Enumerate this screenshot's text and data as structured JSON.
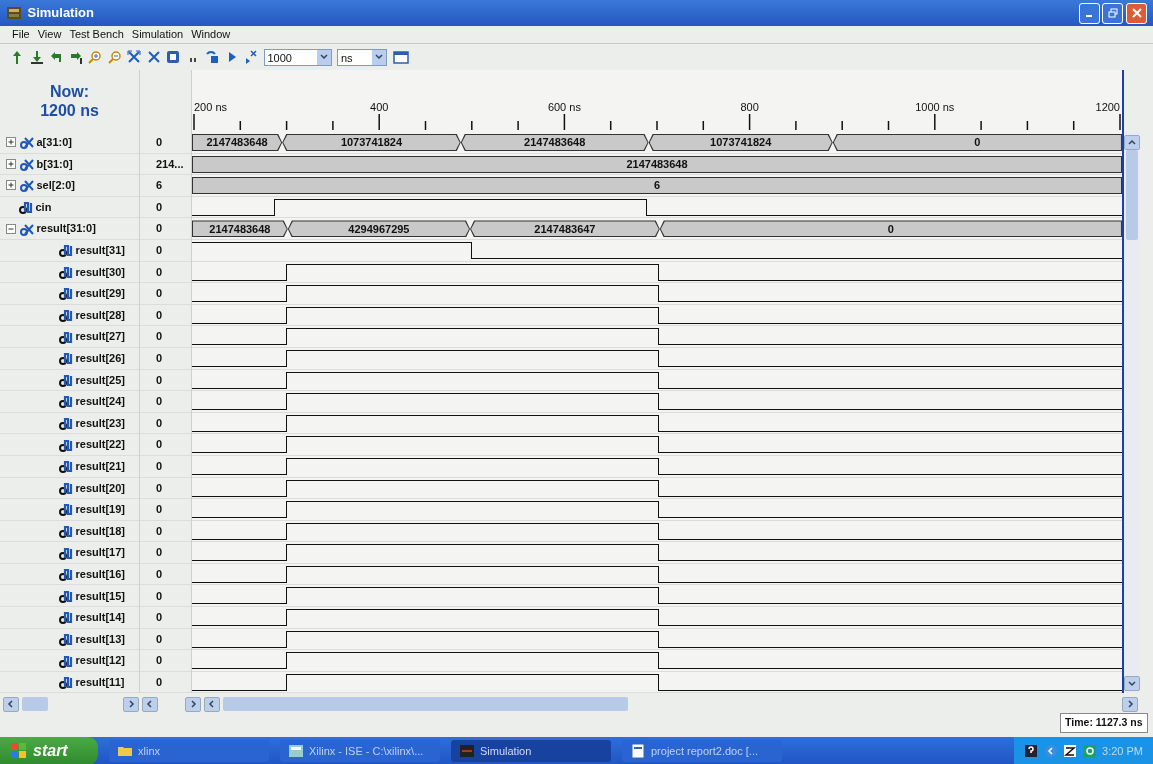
{
  "window": {
    "title": "Simulation"
  },
  "menu": [
    "File",
    "View",
    "Test Bench",
    "Simulation",
    "Window"
  ],
  "toolbar": {
    "run_time": "1000",
    "unit": "ns"
  },
  "now": {
    "label": "Now:",
    "time": "1200 ns"
  },
  "ruler": {
    "labels": [
      "200 ns",
      "400",
      "600 ns",
      "800",
      "1000 ns",
      "1200"
    ]
  },
  "signals": [
    {
      "kind": "bus",
      "name": "a[31:0]",
      "value": "0",
      "expanded": false,
      "segments": [
        {
          "text": "2147483648"
        },
        {
          "text": "1073741824"
        },
        {
          "text": "2147483648"
        },
        {
          "text": "1073741824"
        },
        {
          "text": "0"
        }
      ]
    },
    {
      "kind": "bus",
      "name": "b[31:0]",
      "value": "214...",
      "expanded": false,
      "segments": [
        {
          "text": "2147483648"
        }
      ]
    },
    {
      "kind": "bus",
      "name": "sel[2:0]",
      "value": "6",
      "expanded": false,
      "segments": [
        {
          "text": "6"
        }
      ]
    },
    {
      "kind": "bit",
      "name": "cin",
      "value": "0",
      "segments": [
        {
          "high": false
        },
        {
          "high": true
        },
        {
          "high": false
        }
      ]
    },
    {
      "kind": "bus",
      "name": "result[31:0]",
      "value": "0",
      "expanded": true,
      "segments": [
        {
          "text": "2147483648"
        },
        {
          "text": "4294967295"
        },
        {
          "text": "2147483647"
        },
        {
          "text": "0"
        }
      ],
      "children": [
        {
          "kind": "bit",
          "name": "result[31]",
          "value": "0",
          "segments": [
            {
              "high": true
            },
            {
              "high": false
            }
          ]
        },
        {
          "kind": "bit",
          "name": "result[30]",
          "value": "0",
          "segments": [
            {
              "high": false
            },
            {
              "high": true
            },
            {
              "high": false
            }
          ]
        },
        {
          "kind": "bit",
          "name": "result[29]",
          "value": "0",
          "segments": [
            {
              "high": false
            },
            {
              "high": true
            },
            {
              "high": false
            }
          ]
        },
        {
          "kind": "bit",
          "name": "result[28]",
          "value": "0",
          "segments": [
            {
              "high": false
            },
            {
              "high": true
            },
            {
              "high": false
            }
          ]
        },
        {
          "kind": "bit",
          "name": "result[27]",
          "value": "0",
          "segments": [
            {
              "high": false
            },
            {
              "high": true
            },
            {
              "high": false
            }
          ]
        },
        {
          "kind": "bit",
          "name": "result[26]",
          "value": "0",
          "segments": [
            {
              "high": false
            },
            {
              "high": true
            },
            {
              "high": false
            }
          ]
        },
        {
          "kind": "bit",
          "name": "result[25]",
          "value": "0",
          "segments": [
            {
              "high": false
            },
            {
              "high": true
            },
            {
              "high": false
            }
          ]
        },
        {
          "kind": "bit",
          "name": "result[24]",
          "value": "0",
          "segments": [
            {
              "high": false
            },
            {
              "high": true
            },
            {
              "high": false
            }
          ]
        },
        {
          "kind": "bit",
          "name": "result[23]",
          "value": "0",
          "segments": [
            {
              "high": false
            },
            {
              "high": true
            },
            {
              "high": false
            }
          ]
        },
        {
          "kind": "bit",
          "name": "result[22]",
          "value": "0",
          "segments": [
            {
              "high": false
            },
            {
              "high": true
            },
            {
              "high": false
            }
          ]
        },
        {
          "kind": "bit",
          "name": "result[21]",
          "value": "0",
          "segments": [
            {
              "high": false
            },
            {
              "high": true
            },
            {
              "high": false
            }
          ]
        },
        {
          "kind": "bit",
          "name": "result[20]",
          "value": "0",
          "segments": [
            {
              "high": false
            },
            {
              "high": true
            },
            {
              "high": false
            }
          ]
        },
        {
          "kind": "bit",
          "name": "result[19]",
          "value": "0",
          "segments": [
            {
              "high": false
            },
            {
              "high": true
            },
            {
              "high": false
            }
          ]
        },
        {
          "kind": "bit",
          "name": "result[18]",
          "value": "0",
          "segments": [
            {
              "high": false
            },
            {
              "high": true
            },
            {
              "high": false
            }
          ]
        },
        {
          "kind": "bit",
          "name": "result[17]",
          "value": "0",
          "segments": [
            {
              "high": false
            },
            {
              "high": true
            },
            {
              "high": false
            }
          ]
        },
        {
          "kind": "bit",
          "name": "result[16]",
          "value": "0",
          "segments": [
            {
              "high": false
            },
            {
              "high": true
            },
            {
              "high": false
            }
          ]
        },
        {
          "kind": "bit",
          "name": "result[15]",
          "value": "0",
          "segments": [
            {
              "high": false
            },
            {
              "high": true
            },
            {
              "high": false
            }
          ]
        },
        {
          "kind": "bit",
          "name": "result[14]",
          "value": "0",
          "segments": [
            {
              "high": false
            },
            {
              "high": true
            },
            {
              "high": false
            }
          ]
        },
        {
          "kind": "bit",
          "name": "result[13]",
          "value": "0",
          "segments": [
            {
              "high": false
            },
            {
              "high": true
            },
            {
              "high": false
            }
          ]
        },
        {
          "kind": "bit",
          "name": "result[12]",
          "value": "0",
          "segments": [
            {
              "high": false
            },
            {
              "high": true
            },
            {
              "high": false
            }
          ]
        },
        {
          "kind": "bit",
          "name": "result[11]",
          "value": "0",
          "segments": [
            {
              "high": false
            },
            {
              "high": true
            },
            {
              "high": false
            }
          ]
        }
      ]
    }
  ],
  "status_bar": {
    "time": "Time: 1127.3 ns"
  },
  "taskbar": {
    "start": "start",
    "items": [
      {
        "label": "xlinx",
        "selected": false
      },
      {
        "label": "Xilinx - ISE - C:\\xilinx\\...",
        "selected": false
      },
      {
        "label": "Simulation",
        "selected": true
      },
      {
        "label": "project report2.doc [...",
        "selected": false
      }
    ],
    "clock": "3:20 PM"
  }
}
